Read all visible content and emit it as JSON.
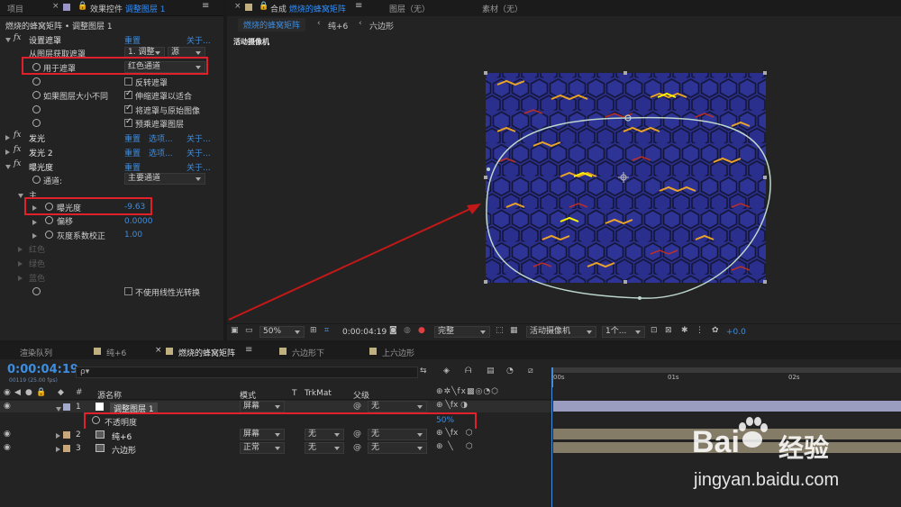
{
  "top_left_tabs": {
    "project": "项目",
    "effects_label": "效果控件",
    "effects_layer": "调整图层 1"
  },
  "effects_header": "燃烧的蜂窝矩阵 • 调整图层 1",
  "effects": {
    "set_matte": {
      "name": "设置遮罩",
      "reset": "重置",
      "about": "关于..."
    },
    "take_matte_label": "从图层获取遮罩",
    "take_matte_value": "1. 调整",
    "take_matte_src": "源",
    "use_for_label": "用于遮罩",
    "use_for_value": "红色通道",
    "invert_label": "反转遮罩",
    "if_size_label": "如果图层大小不同",
    "stretch_label": "伸缩遮罩以适合",
    "composite_label": "将遮罩与原始图像",
    "premult_label": "预乘遮罩图层",
    "glow1": {
      "name": "发光",
      "reset": "重置",
      "options": "选项...",
      "about": "关于..."
    },
    "glow2": {
      "name": "发光 2",
      "reset": "重置",
      "options": "选项...",
      "about": "关于..."
    },
    "exposure": {
      "name": "曝光度",
      "reset": "重置",
      "about": "关于..."
    },
    "channel_label": "通道:",
    "channel_value": "主要通道",
    "master_label": "主",
    "exposure_label": "曝光度",
    "exposure_value": "-9.63",
    "offset_label": "偏移",
    "offset_value": "0.0000",
    "gamma_label": "灰度系数校正",
    "gamma_value": "1.00",
    "red_label": "红色",
    "green_label": "绿色",
    "blue_label": "蓝色",
    "linear_label": "不使用线性光转换"
  },
  "comp_tabs": {
    "comp_prefix": "合成",
    "comp_name": "燃烧的蜂窝矩阵",
    "layer_label": "图层（无）",
    "footage_label": "素材（无）"
  },
  "comp_nav": {
    "active": "燃烧的蜂窝矩阵",
    "item2": "纯+6",
    "item3": "六边形"
  },
  "active_camera": "活动摄像机",
  "viewer_toolbar": {
    "zoom": "50%",
    "timecode": "0:00:04:19",
    "quality": "完整",
    "camera": "活动摄像机",
    "views": "1个...",
    "exposure": "+0.0"
  },
  "timeline_tabs": {
    "render_queue": "渲染队列",
    "tab1": "纯+6",
    "tab2": "燃烧的蜂窝矩阵",
    "tab3": "六边形下",
    "tab4": "上六边形"
  },
  "timecode": "0:00:04:19",
  "timecode_sub": "00119 (25.00 fps)",
  "search_placeholder": "ρ▾",
  "ruler": {
    "t0": "00s",
    "t1": "01s",
    "t2": "02s"
  },
  "columns": {
    "source_name": "源名称",
    "mode": "模式",
    "t": "T",
    "trkmat": "TrkMat",
    "parent": "父级"
  },
  "layers": [
    {
      "num": "1",
      "name": "调整图层 1",
      "mode": "屏幕",
      "trkmat": "",
      "parent": "无"
    },
    {
      "num": "2",
      "name": "纯+6",
      "mode": "屏幕",
      "trkmat": "无",
      "parent": "无"
    },
    {
      "num": "3",
      "name": "六边形",
      "mode": "正常",
      "trkmat": "无",
      "parent": "无"
    }
  ],
  "opacity": {
    "label": "不透明度",
    "value": "50",
    "unit": "%"
  },
  "watermark": {
    "brand_a": "Bai",
    "brand_b": "经验",
    "url": "jingyan.baidu.com"
  }
}
